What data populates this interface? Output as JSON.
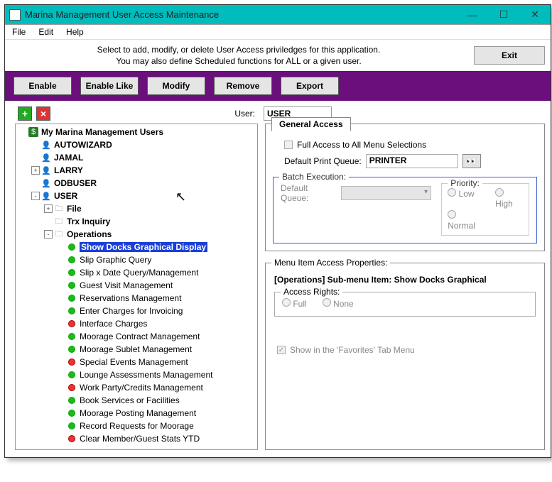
{
  "window": {
    "title": "Marina Management User Access Maintenance"
  },
  "menu": [
    "File",
    "Edit",
    "Help"
  ],
  "instructions": {
    "line1": "Select to add, modify, or delete User Access priviledges for this application.",
    "line2": "You may also define Scheduled functions for ALL or a given user."
  },
  "buttons": {
    "exit": "Exit",
    "enable": "Enable",
    "enable_like": "Enable Like",
    "modify": "Modify",
    "remove": "Remove",
    "export": "Export"
  },
  "user_field": {
    "label": "User:",
    "value": "USER"
  },
  "tree": {
    "root": "My Marina Management Users",
    "items": [
      {
        "indent": 0,
        "exp": "",
        "icon": "root",
        "label": "My Marina Management Users",
        "bold": true
      },
      {
        "indent": 1,
        "exp": "",
        "icon": "person",
        "label": "AUTOWIZARD",
        "bold": true
      },
      {
        "indent": 1,
        "exp": "",
        "icon": "person",
        "label": "JAMAL",
        "bold": true
      },
      {
        "indent": 1,
        "exp": "+",
        "icon": "person",
        "label": "LARRY",
        "bold": true
      },
      {
        "indent": 1,
        "exp": "",
        "icon": "person",
        "label": "ODBUSER",
        "bold": true
      },
      {
        "indent": 1,
        "exp": "-",
        "icon": "person",
        "label": "USER",
        "bold": true
      },
      {
        "indent": 2,
        "exp": "+",
        "icon": "folder",
        "label": "File",
        "bold": true
      },
      {
        "indent": 2,
        "exp": "",
        "icon": "folder",
        "label": "Trx Inquiry",
        "bold": true
      },
      {
        "indent": 2,
        "exp": "-",
        "icon": "folder",
        "label": "Operations",
        "bold": true
      },
      {
        "indent": 3,
        "exp": "",
        "icon": "dot-g",
        "label": "Show Docks Graphical Display",
        "bold": true,
        "selected": true
      },
      {
        "indent": 3,
        "exp": "",
        "icon": "dot-g",
        "label": "Slip Graphic Query"
      },
      {
        "indent": 3,
        "exp": "",
        "icon": "dot-g",
        "label": "Slip x Date Query/Management"
      },
      {
        "indent": 3,
        "exp": "",
        "icon": "dot-g",
        "label": "Guest Visit Management"
      },
      {
        "indent": 3,
        "exp": "",
        "icon": "dot-g",
        "label": "Reservations Management"
      },
      {
        "indent": 3,
        "exp": "",
        "icon": "dot-g",
        "label": "Enter Charges for Invoicing"
      },
      {
        "indent": 3,
        "exp": "",
        "icon": "dot-r",
        "label": "Interface Charges"
      },
      {
        "indent": 3,
        "exp": "",
        "icon": "dot-g",
        "label": "Moorage Contract Management"
      },
      {
        "indent": 3,
        "exp": "",
        "icon": "dot-g",
        "label": "Moorage Sublet Management"
      },
      {
        "indent": 3,
        "exp": "",
        "icon": "dot-r",
        "label": "Special Events Management"
      },
      {
        "indent": 3,
        "exp": "",
        "icon": "dot-g",
        "label": "Lounge Assessments Management"
      },
      {
        "indent": 3,
        "exp": "",
        "icon": "dot-r",
        "label": "Work Party/Credits Management"
      },
      {
        "indent": 3,
        "exp": "",
        "icon": "dot-g",
        "label": "Book Services or Facilities"
      },
      {
        "indent": 3,
        "exp": "",
        "icon": "dot-g",
        "label": "Moorage Posting Management"
      },
      {
        "indent": 3,
        "exp": "",
        "icon": "dot-g",
        "label": "Record Requests for Moorage"
      },
      {
        "indent": 3,
        "exp": "",
        "icon": "dot-r",
        "label": "Clear Member/Guest Stats YTD"
      }
    ]
  },
  "general_access": {
    "tab_label": "General Access",
    "full_access_label": "Full Access to All Menu Selections",
    "default_print_queue_label": "Default Print Queue:",
    "default_print_queue_value": "PRINTER",
    "batch": {
      "legend": "Batch Execution:",
      "default_queue_label": "Default Queue:",
      "priority_legend": "Priority:",
      "opts": [
        "Low",
        "High",
        "Normal"
      ]
    }
  },
  "menu_item_props": {
    "legend": "Menu Item Access Properties:",
    "title": "[Operations] Sub-menu Item: Show Docks Graphical",
    "access_legend": "Access Rights:",
    "access_opts": [
      "Full",
      "None"
    ],
    "fav_label": "Show in the 'Favorites' Tab Menu"
  }
}
